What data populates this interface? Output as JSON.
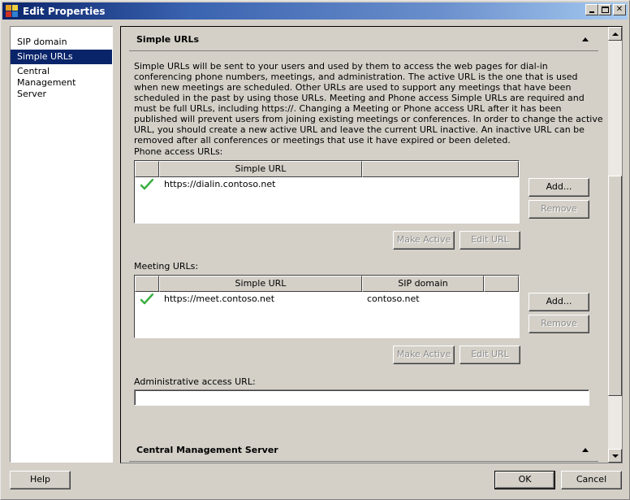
{
  "window": {
    "title": "Edit Properties",
    "controls": {
      "minimize": "minimize",
      "maximize": "maximize",
      "close": "close"
    }
  },
  "nav": {
    "items": [
      {
        "label": "SIP domain",
        "selected": false
      },
      {
        "label": "Simple URLs",
        "selected": true
      },
      {
        "label": "Central Management Server",
        "selected": false
      }
    ]
  },
  "simple_urls": {
    "header": "Simple URLs",
    "description": "Simple URLs will be sent to your users and used by them to access the web pages for dial-in conferencing phone numbers, meetings, and administration. The active URL is the one that is used when new meetings are scheduled. Other URLs are used to support any meetings that have been scheduled in the past by using those URLs. Meeting and Phone access Simple URLs are required and must be full URLs, including https://.  Changing a Meeting or Phone access URL after it has been published will prevent users from joining existing meetings or conferences.  In order to change the active URL, you should create a new active URL and leave the current URL inactive.  An inactive URL can be removed after all conferences or meetings that use it have expired or been deleted.",
    "phone": {
      "label": "Phone access URLs:",
      "columns": [
        "",
        "Simple URL",
        ""
      ],
      "rows": [
        {
          "active": true,
          "url": "https://dialin.contoso.net"
        }
      ],
      "add_label": "Add...",
      "remove_label": "Remove",
      "make_active_label": "Make Active",
      "edit_label": "Edit URL"
    },
    "meeting": {
      "label": "Meeting URLs:",
      "columns": [
        "",
        "Simple URL",
        "SIP domain",
        ""
      ],
      "rows": [
        {
          "active": true,
          "url": "https://meet.contoso.net",
          "sip_domain": "contoso.net"
        }
      ],
      "add_label": "Add...",
      "remove_label": "Remove",
      "make_active_label": "Make Active",
      "edit_label": "Edit URL"
    },
    "admin": {
      "label": "Administrative access URL:",
      "value": ""
    }
  },
  "cms": {
    "header": "Central Management Server"
  },
  "scroll": {
    "thumb_start_fraction": 0.33,
    "thumb_end_fraction": 0.87
  },
  "footer": {
    "help_label": "Help",
    "ok_label": "OK",
    "cancel_label": "Cancel"
  },
  "colors": {
    "selection": "#0a246a",
    "check": "#3cb043",
    "face": "#d4d0c8"
  }
}
